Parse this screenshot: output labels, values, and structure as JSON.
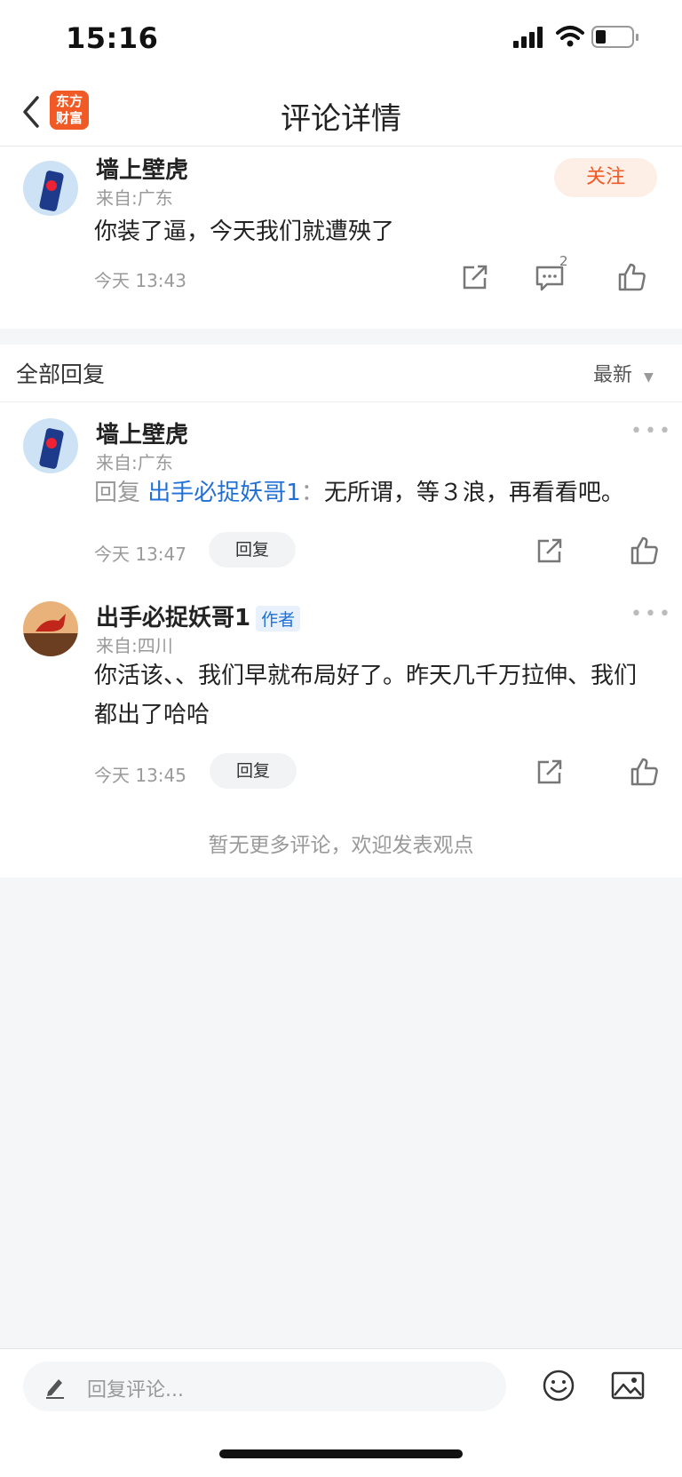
{
  "status_bar": {
    "time": "15:16"
  },
  "nav": {
    "title": "评论详情",
    "brand_line1": "东方",
    "brand_line2": "财富"
  },
  "main_comment": {
    "author": "墙上壁虎",
    "location": "来自:广东",
    "text": "你装了逼，今天我们就遭殃了",
    "time": "今天 13:43",
    "comment_count": "2",
    "follow_label": "关注"
  },
  "replies_header": {
    "title": "全部回复",
    "sort_label": "最新"
  },
  "replies": [
    {
      "author": "墙上壁虎",
      "location": "来自:广东",
      "reply_prefix": "回复",
      "reply_to": "出手必捉妖哥1",
      "colon": "：",
      "text": "无所谓，等３浪，再看看吧。",
      "time": "今天 13:47",
      "reply_button": "回复"
    },
    {
      "author": "出手必捉妖哥1",
      "badge": "作者",
      "location": "来自:四川",
      "text": "你活该、、我们早就布局好了。昨天几千万拉伸、我们都出了哈哈",
      "time": "今天 13:45",
      "reply_button": "回复"
    }
  ],
  "footer_note": "暂无更多评论，欢迎发表观点",
  "input": {
    "placeholder": "回复评论..."
  },
  "colors": {
    "brand": "#f15a24",
    "link": "#1f6fd6"
  }
}
